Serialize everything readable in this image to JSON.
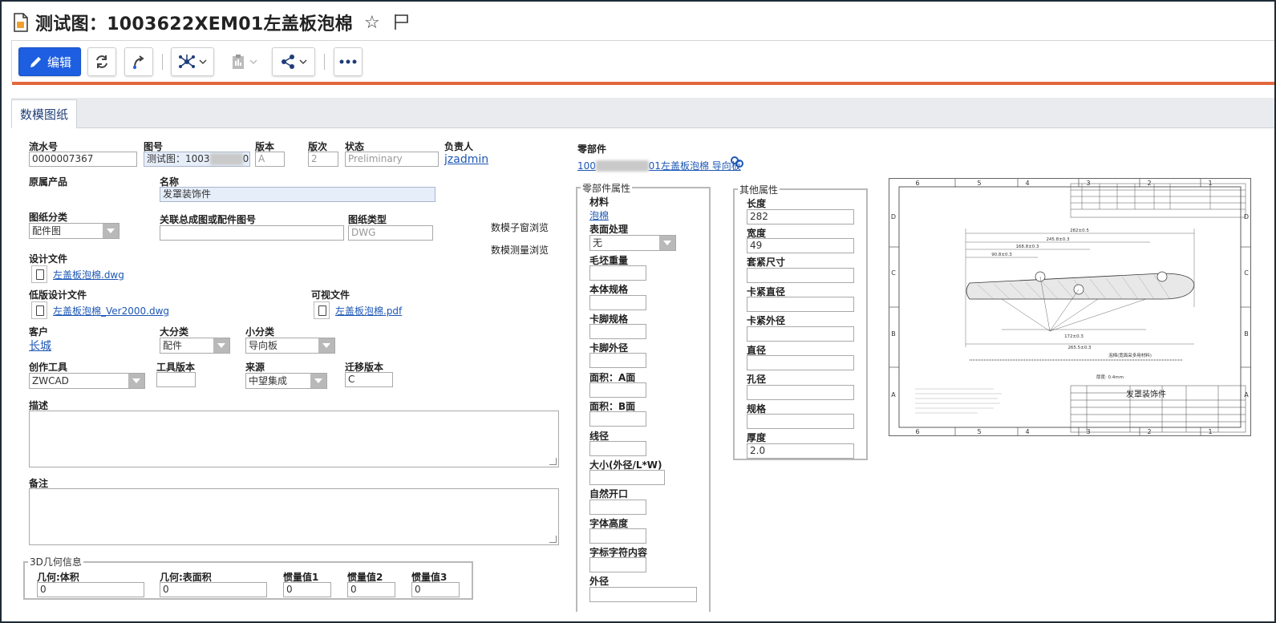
{
  "page": {
    "title": "测试图：1003622XEM01左盖板泡棉"
  },
  "toolbar": {
    "edit_label": "编辑"
  },
  "tabs": [
    {
      "label": "数模图纸"
    }
  ],
  "form": {
    "serial_label": "流水号",
    "serial_value": "0000007367",
    "drawing_no_label": "图号",
    "drawing_no_value": "测试图：1003",
    "version_label": "版本",
    "version_value": "A",
    "revision_label": "版次",
    "revision_value": "2",
    "status_label": "状态",
    "status_value": "Preliminary",
    "owner_label": "负责人",
    "owner_value": "jzadmin",
    "orig_product_label": "原属产品",
    "name_label": "名称",
    "name_value": "发罩装饰件",
    "drawing_class_label": "图纸分类",
    "drawing_class_value": "配件图",
    "assembly_no_label": "关联总成图或配件图号",
    "assembly_no_value": "",
    "drawing_type_label": "图纸类型",
    "drawing_type_value": "DWG",
    "sub_window_browse": "数模子窗浏览",
    "measure_browse": "数模测量浏览",
    "design_file_label": "设计文件",
    "design_file_value": "左盖板泡棉.dwg",
    "low_design_file_label": "低版设计文件",
    "low_design_file_value": "左盖板泡棉_Ver2000.dwg",
    "visual_file_label": "可视文件",
    "visual_file_value": "左盖板泡棉.pdf",
    "customer_label": "客户",
    "customer_value": "长城",
    "major_class_label": "大分类",
    "major_class_value": "配件",
    "minor_class_label": "小分类",
    "minor_class_value": "导向板",
    "tool_label": "创作工具",
    "tool_value": "ZWCAD",
    "tool_version_label": "工具版本",
    "tool_version_value": "",
    "source_label": "来源",
    "source_value": "中望集成",
    "migrate_version_label": "迁移版本",
    "migrate_version_value": "C",
    "desc_label": "描述",
    "remark_label": "备注"
  },
  "geometry": {
    "legend": "3D几何信息",
    "volume_label": "几何:体积",
    "volume_value": "0",
    "surface_label": "几何:表面积",
    "surface_value": "0",
    "inertia1_label": "惯量值1",
    "inertia1_value": "0",
    "inertia2_label": "惯量值2",
    "inertia2_value": "0",
    "inertia3_label": "惯量值3",
    "inertia3_value": "0"
  },
  "part": {
    "label": "零部件",
    "link_start": "100",
    "link_end": "01左盖板泡棉 导向板"
  },
  "part_props": {
    "legend": "零部件属性",
    "material_label": "材料",
    "material_value": "泡棉",
    "surface_treat_label": "表面处理",
    "surface_treat_value": "无",
    "blank_weight_label": "毛坯重量",
    "body_spec_label": "本体规格",
    "clip_spec_label": "卡脚规格",
    "clip_od_label": "卡脚外径",
    "area_a_label": "面积：A面",
    "area_b_label": "面积：B面",
    "wire_dia_label": "线径",
    "size_label": "大小(外径/L*W)",
    "natural_open_label": "自然开口",
    "char_height_label": "字体高度",
    "char_content_label": "字标字符内容",
    "outer_dia_label": "外径"
  },
  "other_props": {
    "legend": "其他属性",
    "length_label": "长度",
    "length_value": "282",
    "width_label": "宽度",
    "width_value": "49",
    "sleeve_label": "套紧尺寸",
    "sleeve_value": "",
    "clamp_dia_label": "卡紧直径",
    "clamp_dia_value": "",
    "clamp_od_label": "卡紧外径",
    "clamp_od_value": "",
    "diameter_label": "直径",
    "diameter_value": "",
    "hole_label": "孔径",
    "hole_value": "",
    "spec_label": "规格",
    "spec_value": "",
    "thickness_label": "厚度",
    "thickness_value": "2.0"
  },
  "drawing_preview": {
    "col_numbers": [
      "6",
      "5",
      "4",
      "3",
      "2",
      "1"
    ],
    "row_letters": [
      "D",
      "C",
      "B",
      "A"
    ],
    "title_block_name": "发罩装饰件",
    "dim_282": "282±0.5",
    "dim_245": "245.8±0.3",
    "dim_168": "168.8±0.3",
    "dim_90": "90.8±0.3",
    "dim_172": "172±0.3",
    "dim_265": "265.5±0.3",
    "note_foam": "泡棉(宽面采多用材料)",
    "note_thick": "厚度: 0.4mm"
  },
  "icons": {
    "accent_color": "#e2693d",
    "primary_color": "#1e5ee0",
    "link_color": "#1d57b5"
  }
}
